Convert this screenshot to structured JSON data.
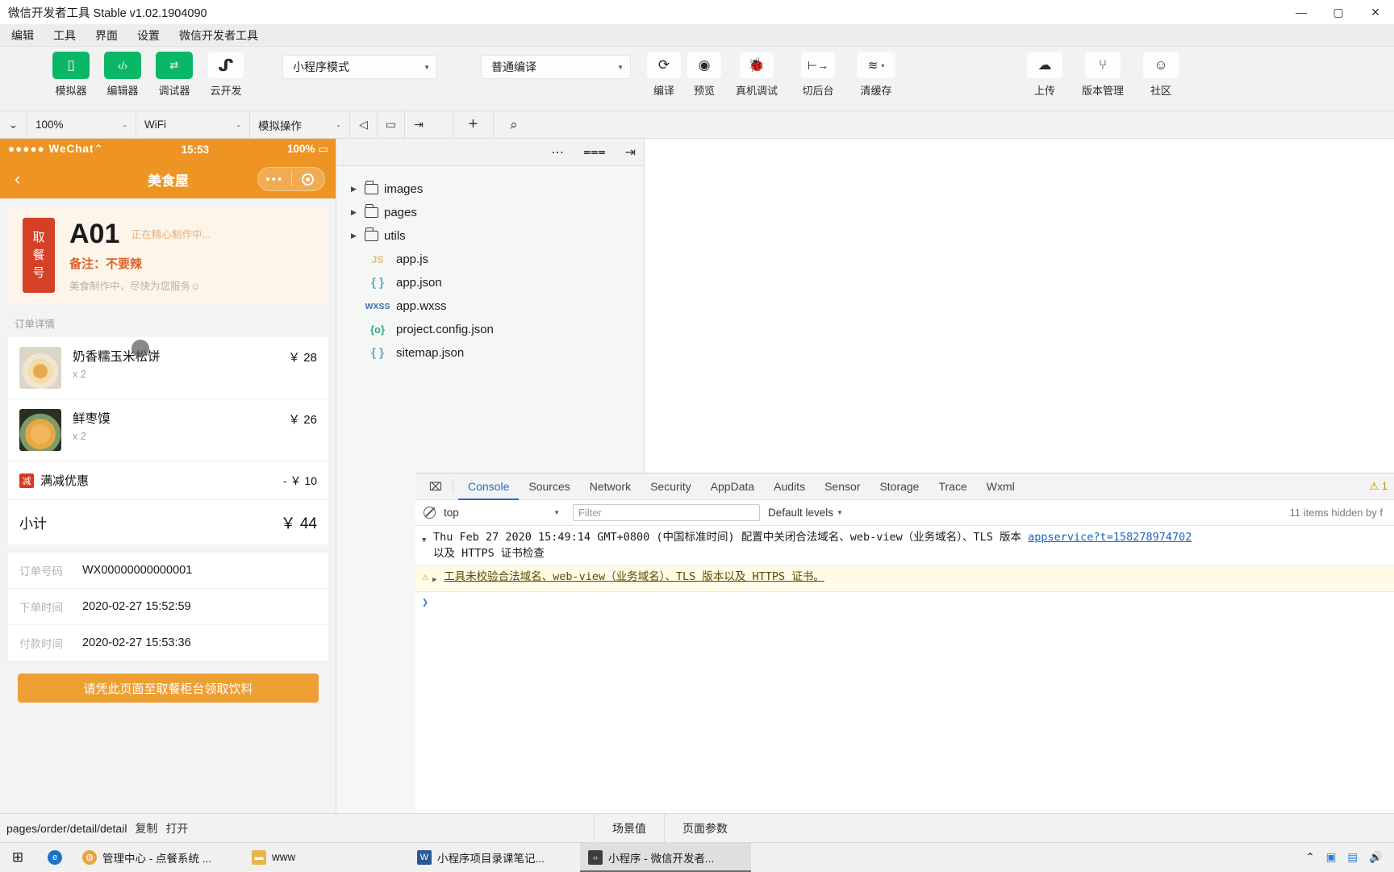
{
  "window": {
    "title": "微信开发者工具 Stable v1.02.1904090",
    "minimize": "—",
    "maximize": "▢",
    "close": "✕"
  },
  "menubar": {
    "items": [
      "编辑",
      "工具",
      "界面",
      "设置",
      "微信开发者工具"
    ]
  },
  "toolbar": {
    "buttons": [
      {
        "label": "模拟器",
        "icon": "phone-icon",
        "glyph": "▯",
        "style": "green"
      },
      {
        "label": "编辑器",
        "icon": "code-icon",
        "glyph": "‹/›",
        "style": "green"
      },
      {
        "label": "调试器",
        "icon": "debugger-icon",
        "glyph": "⇄",
        "style": "green"
      },
      {
        "label": "云开发",
        "icon": "cloud-dev-icon",
        "glyph": "ᔑ",
        "style": "plain"
      }
    ],
    "mode_select": {
      "value": "小程序模式",
      "caret": "▼"
    },
    "compile_select": {
      "value": "普通编译",
      "caret": "▼"
    },
    "actions": [
      {
        "label": "编译",
        "icon": "refresh-icon",
        "glyph": "⟳"
      },
      {
        "label": "预览",
        "icon": "eye-icon",
        "glyph": "◉"
      },
      {
        "label": "真机调试",
        "icon": "bug-icon",
        "glyph": "🐞"
      },
      {
        "label": "切后台",
        "icon": "background-icon",
        "glyph": "⊢→"
      },
      {
        "label": "清缓存",
        "icon": "layers-icon",
        "glyph": "≋",
        "caret": "▾"
      }
    ],
    "right_actions": [
      {
        "label": "上传",
        "icon": "upload-cloud-icon",
        "glyph": "☁"
      },
      {
        "label": "版本管理",
        "icon": "branch-icon",
        "glyph": "⑂"
      },
      {
        "label": "社区",
        "icon": "chat-icon",
        "glyph": "☺"
      }
    ]
  },
  "simbar": {
    "collapse_caret": "⌄",
    "zoom": {
      "value": "100%",
      "caret": "⌄"
    },
    "network": {
      "value": "WiFi",
      "caret": "⌄"
    },
    "simulate": {
      "value": "模拟操作",
      "caret": "⌄"
    },
    "icons": [
      {
        "name": "volume-icon",
        "glyph": "◁"
      },
      {
        "name": "screen-icon",
        "glyph": "▭"
      },
      {
        "name": "detach-icon",
        "glyph": "⇥"
      }
    ]
  },
  "phone": {
    "status": {
      "carrier": "●●●●● WeChat",
      "wifi": "⌃",
      "time": "15:53",
      "battery": "100%",
      "battery_icon": "▭"
    },
    "nav": {
      "back": "‹",
      "title": "美食屋",
      "menu_dots": "•••",
      "target": "◎"
    },
    "order": {
      "badge": "取餐号",
      "number": "A01",
      "status": "正在精心制作中...",
      "remark": "备注：不要辣",
      "tip": "美食制作中，尽快为您服务☺"
    },
    "detail_title": "订单详情",
    "goods": [
      {
        "name": "奶香糯玉米松饼",
        "qty": "x 2",
        "price": "￥ 28",
        "thumb": "pancake"
      },
      {
        "name": "鲜枣馍",
        "qty": "x 2",
        "price": "￥ 26",
        "thumb": "bun"
      }
    ],
    "discount": {
      "tag": "减",
      "name": "满减优惠",
      "value": "- ￥ 10"
    },
    "total": {
      "label": "小计",
      "value": "￥ 44"
    },
    "meta": [
      {
        "label": "订单号码",
        "value": "WX00000000000001"
      },
      {
        "label": "下单时间",
        "value": "2020-02-27 15:52:59"
      },
      {
        "label": "付款时间",
        "value": "2020-02-27 15:53:36"
      }
    ],
    "cta": "请凭此页面至取餐柜台领取饮料"
  },
  "files": {
    "header_icons": [
      {
        "name": "add-file-icon",
        "glyph": "+"
      },
      {
        "name": "search-icon",
        "glyph": "⌕"
      },
      {
        "name": "more-icon",
        "glyph": "⋯"
      },
      {
        "name": "sort-icon",
        "glyph": "⩶"
      },
      {
        "name": "panel-toggle-icon",
        "glyph": "⇥"
      }
    ],
    "tree": [
      {
        "type": "folder",
        "name": "images",
        "arrow": "▶"
      },
      {
        "type": "folder",
        "name": "pages",
        "arrow": "▶"
      },
      {
        "type": "folder",
        "name": "utils",
        "arrow": "▶"
      },
      {
        "type": "js",
        "name": "app.js",
        "badge": "JS"
      },
      {
        "type": "json",
        "name": "app.json",
        "badge": "{ }"
      },
      {
        "type": "wxss",
        "name": "app.wxss",
        "badge": "WXSS"
      },
      {
        "type": "proj",
        "name": "project.config.json",
        "badge": "{o}"
      },
      {
        "type": "json",
        "name": "sitemap.json",
        "badge": "{ }"
      }
    ]
  },
  "devtools": {
    "inspect_icon": "⌧",
    "tabs": [
      "Console",
      "Sources",
      "Network",
      "Security",
      "AppData",
      "Audits",
      "Sensor",
      "Storage",
      "Trace",
      "Wxml"
    ],
    "active_tab": "Console",
    "warning_badge": "⚠ 1",
    "filterbar": {
      "clear_icon": "clear-console-icon",
      "context": "top",
      "context_caret": "▼",
      "filter_placeholder": "Filter",
      "levels": "Default levels",
      "levels_caret": "▼",
      "hidden_note": "11 items hidden by f"
    },
    "messages": [
      {
        "type": "info",
        "triangle": "▼",
        "text": "Thu Feb 27 2020 15:49:14 GMT+0800 (中国标准时间) 配置中关闭合法域名、web-view（业务域名）、TLS 版本",
        "link": "appservice?t=158278974702",
        "text2": "以及 HTTPS 证书检查"
      },
      {
        "type": "warn",
        "icon": "⚠",
        "triangle": "▶",
        "text": "工具未校验合法域名、web-view（业务域名）、TLS 版本以及 HTTPS 证书。"
      }
    ],
    "prompt": "❯"
  },
  "pathbar": {
    "path": "pages/order/detail/detail",
    "copy": "复制",
    "open": "打开",
    "buttons": [
      "场景值",
      "页面参数"
    ]
  },
  "taskbar": {
    "start_icon": "⊞",
    "tasks": [
      {
        "label": "",
        "icon": "edge-icon",
        "glyph": "e",
        "color": "#1a73c8",
        "active": false
      },
      {
        "label": "管理中心 - 点餐系统 ...",
        "icon": "chrome-icon",
        "glyph": "◍",
        "color": "#e8a33d",
        "active": false
      },
      {
        "label": "www",
        "icon": "folder-icon",
        "glyph": "▬",
        "color": "#e8b64a",
        "active": false
      },
      {
        "label": "小程序项目录课笔记...",
        "icon": "doc-icon",
        "glyph": "W",
        "color": "#2b579a",
        "active": false
      },
      {
        "label": "小程序 - 微信开发者...",
        "icon": "wechat-devtools-icon",
        "glyph": "‹›",
        "color": "#3d3d3d",
        "active": true
      }
    ],
    "tray": [
      {
        "name": "chevron-up-icon",
        "glyph": "⌃"
      },
      {
        "name": "monitor-icon",
        "glyph": "▣"
      },
      {
        "name": "network-icon",
        "glyph": "▤"
      },
      {
        "name": "volume-icon",
        "glyph": "🔊"
      }
    ]
  },
  "colors": {
    "brand_green": "#0ab766",
    "wechat_orange": "#ee9422",
    "badge_red": "#d64027",
    "link_blue": "#1a63c4"
  }
}
